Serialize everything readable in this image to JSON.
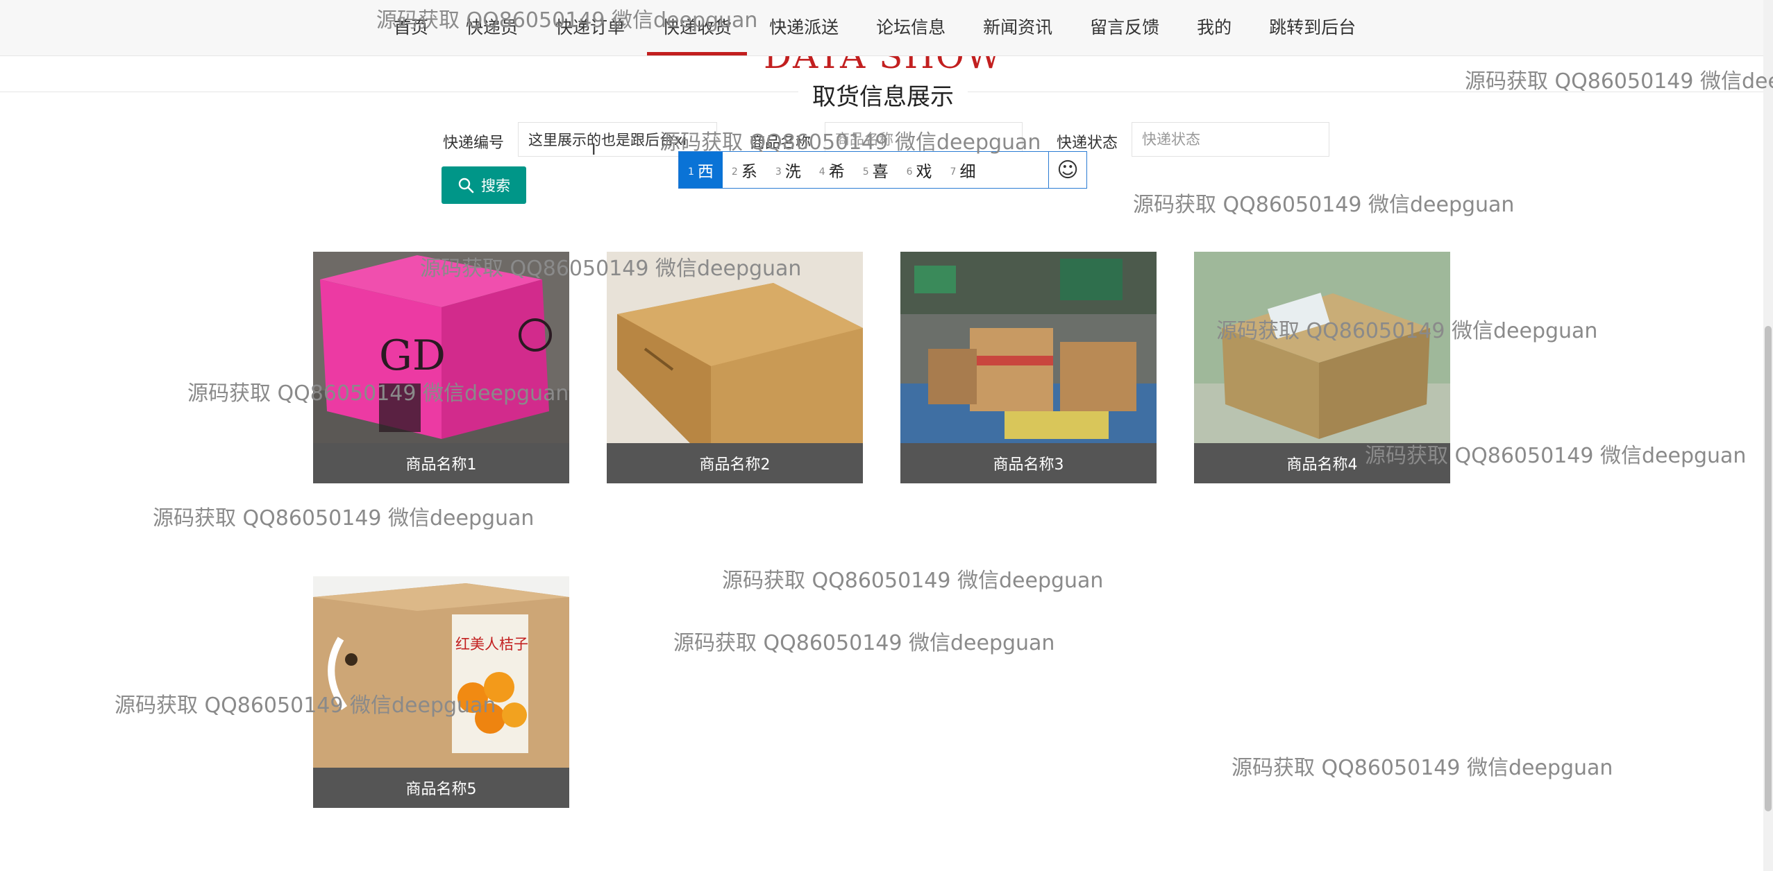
{
  "nav": {
    "items": [
      {
        "label": "首页"
      },
      {
        "label": "快递员"
      },
      {
        "label": "快递订单"
      },
      {
        "label": "快递收货"
      },
      {
        "label": "快递派送"
      },
      {
        "label": "论坛信息"
      },
      {
        "label": "新闻资讯"
      },
      {
        "label": "留言反馈"
      },
      {
        "label": "我的"
      },
      {
        "label": "跳转到后台"
      }
    ],
    "active_index": 3
  },
  "banner": {
    "text": "DATA SHOW"
  },
  "page_title": "取货信息展示",
  "search": {
    "fields": [
      {
        "label": "快递编号",
        "value": "这里展示的也是跟后台xi",
        "placeholder": ""
      },
      {
        "label": "商品名称",
        "value": "",
        "placeholder": "商品名称"
      },
      {
        "label": "快递状态",
        "value": "",
        "placeholder": "快递状态"
      }
    ],
    "button_label": "搜索"
  },
  "ime": {
    "candidates": [
      {
        "num": "1",
        "text": "西"
      },
      {
        "num": "2",
        "text": "系"
      },
      {
        "num": "3",
        "text": "洗"
      },
      {
        "num": "4",
        "text": "希"
      },
      {
        "num": "5",
        "text": "喜"
      },
      {
        "num": "6",
        "text": "戏"
      },
      {
        "num": "7",
        "text": "细"
      }
    ],
    "emoji": "☺"
  },
  "products": [
    {
      "name": "商品名称1",
      "image": "pink-box"
    },
    {
      "name": "商品名称2",
      "image": "flat-box"
    },
    {
      "name": "商品名称3",
      "image": "parcels"
    },
    {
      "name": "商品名称4",
      "image": "taped-box"
    },
    {
      "name": "商品名称5",
      "image": "orange-box"
    }
  ],
  "orange_label": "红美人桔子",
  "pink_logo": "GD",
  "watermark": "源码获取 QQ86050149 微信deepguan",
  "colors": {
    "accent": "#c21f1f",
    "button": "#009688",
    "caption_bg": "#555555",
    "ime_blue": "#0a73d6"
  }
}
